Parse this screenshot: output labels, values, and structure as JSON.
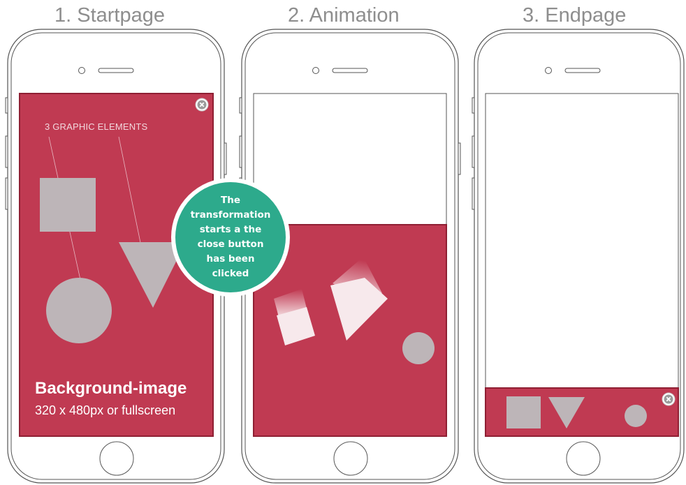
{
  "steps": [
    {
      "title": "1. Startpage"
    },
    {
      "title": "2. Animation"
    },
    {
      "title": "3. Endpage"
    }
  ],
  "startpage": {
    "graphic_label": "3 GRAPHIC ELEMENTS",
    "background_title": "Background-image",
    "background_subtitle": "320 x 480px or fullscreen"
  },
  "callout": {
    "text": "The transformation starts a the close button has been clicked"
  },
  "colors": {
    "ad_background": "#c03a52",
    "ad_border": "#8f1f33",
    "shape_gray": "#bdb5b8",
    "callout_green": "#2daa8c",
    "title_gray": "#8e8e8e"
  },
  "icons": [
    "close-icon",
    "square-shape",
    "triangle-shape",
    "circle-shape",
    "home-button",
    "speaker-slot",
    "camera-dot"
  ]
}
